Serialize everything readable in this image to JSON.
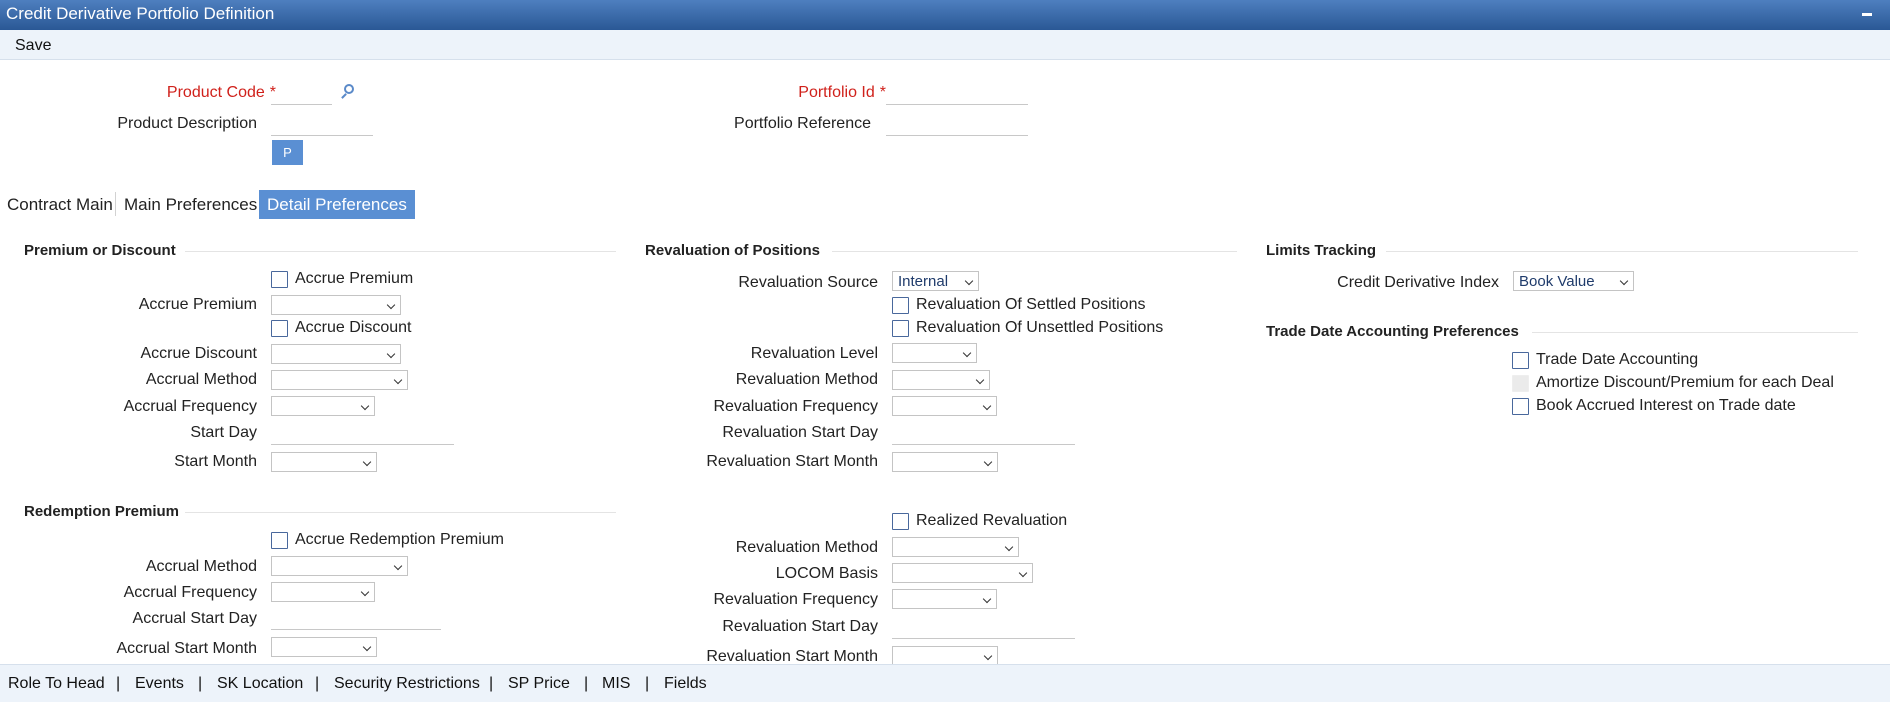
{
  "window": {
    "title": "Credit Derivative Portfolio Definition"
  },
  "toolbar": {
    "save_label": "Save"
  },
  "header": {
    "product_code_label": "Product Code",
    "product_description_label": "Product Description",
    "portfolio_id_label": "Portfolio Id",
    "portfolio_reference_label": "Portfolio Reference",
    "required_mark": "*",
    "p_button_label": "P"
  },
  "tabs": [
    {
      "label": "Contract Main"
    },
    {
      "label": "Main Preferences"
    },
    {
      "label": "Detail Preferences",
      "active": true
    }
  ],
  "premium_discount": {
    "heading": "Premium or Discount",
    "accrue_premium_checkbox": "Accrue Premium",
    "accrue_premium_label": "Accrue Premium",
    "accrue_discount_checkbox": "Accrue Discount",
    "accrue_discount_label": "Accrue Discount",
    "accrual_method_label": "Accrual Method",
    "accrual_frequency_label": "Accrual Frequency",
    "start_day_label": "Start Day",
    "start_month_label": "Start Month"
  },
  "redemption": {
    "heading": "Redemption Premium",
    "accrue_checkbox": "Accrue Redemption Premium",
    "accrual_method_label": "Accrual Method",
    "accrual_frequency_label": "Accrual Frequency",
    "accrual_start_day_label": "Accrual Start Day",
    "accrual_start_month_label": "Accrual Start Month"
  },
  "revaluation": {
    "heading": "Revaluation of Positions",
    "source_label": "Revaluation Source",
    "source_value": "Internal",
    "settled_checkbox": "Revaluation Of Settled Positions",
    "unsettled_checkbox": "Revaluation Of Unsettled Positions",
    "level_label": "Revaluation Level",
    "method_label": "Revaluation Method",
    "frequency_label": "Revaluation Frequency",
    "start_day_label": "Revaluation Start Day",
    "start_month_label": "Revaluation Start Month",
    "realized_checkbox": "Realized Revaluation",
    "realized_method_label": "Revaluation Method",
    "locom_label": "LOCOM Basis",
    "realized_frequency_label": "Revaluation Frequency",
    "realized_start_day_label": "Revaluation Start Day",
    "realized_start_month_label": "Revaluation Start Month"
  },
  "limits": {
    "heading": "Limits Tracking",
    "cdi_label": "Credit Derivative Index",
    "cdi_value": "Book Value"
  },
  "trade_date": {
    "heading": "Trade Date Accounting Preferences",
    "trade_date_checkbox": "Trade Date Accounting",
    "amortize_checkbox": "Amortize Discount/Premium for each Deal",
    "book_accrued_checkbox": "Book Accrued Interest on Trade date"
  },
  "footer": {
    "links": [
      "Role To Head",
      "Events",
      "SK Location",
      "Security Restrictions",
      "SP Price",
      "MIS",
      "Fields"
    ],
    "separator": "|"
  },
  "colors": {
    "title_bar": "#2a5895",
    "accent": "#5a8fd3",
    "required": "#d0211b",
    "toolbar_bg": "#edf3fa"
  }
}
